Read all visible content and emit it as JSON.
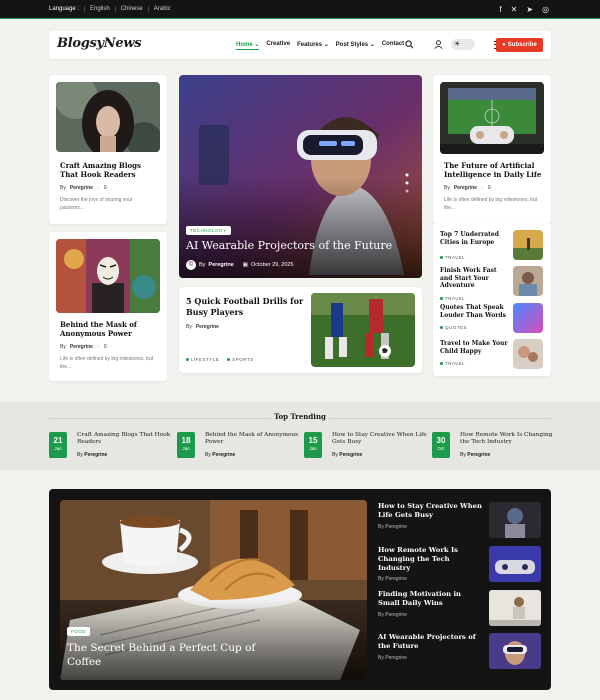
{
  "topbar": {
    "language_label": "Language :",
    "languages": [
      "English",
      "Chinese",
      "Arabic"
    ],
    "social_icons": [
      "facebook-icon",
      "x-icon",
      "telegram-icon",
      "instagram-icon"
    ]
  },
  "header": {
    "logo": "BlogsyNews",
    "nav": [
      "Home",
      "Creative",
      "Features",
      "Post Styles",
      "Contact"
    ],
    "subscribe_label": "Subscribe",
    "accent_color": "#1d9b4a",
    "subscribe_color": "#e63a27"
  },
  "left_cards": [
    {
      "title": "Craft Amazing Blogs That Hook Readers",
      "by": "By",
      "author": "Peregrine",
      "comments": "0",
      "excerpt": "Discover the joys of sharing your passions..."
    },
    {
      "title": "Behind the Mask of Anonymous Power",
      "by": "By",
      "author": "Peregrine",
      "comments": "0",
      "excerpt": "Life is often defined by big milestones, but the..."
    }
  ],
  "hero": {
    "category": "TECHNOLOGY",
    "title": "AI Wearable Projectors of the Future",
    "by": "By",
    "author": "Peregrine",
    "date": "October 29, 2025"
  },
  "football": {
    "title": "5 Quick Football Drills for Busy Players",
    "by": "By",
    "author": "Peregrine",
    "tags": [
      "LIFESTYLE",
      "SPORTS"
    ]
  },
  "right_card": {
    "title": "The Future of Artificial Intelligence in Daily Life",
    "by": "By",
    "author": "Peregrine",
    "comments": "0",
    "excerpt": "Life is often defined by big milestones, but the..."
  },
  "right_list": [
    {
      "title": "Top 7 Underrated Cities in Europe",
      "tag": "TRAVEL"
    },
    {
      "title": "Finish Work Fast and Start Your Adventure",
      "tag": "TRAVEL"
    },
    {
      "title": "Quotes That Speak Louder Than Words",
      "tag": "QUOTES"
    },
    {
      "title": "Travel to Make Your Child Happy",
      "tag": "TRAVEL"
    }
  ],
  "trending": {
    "heading": "Top Trending",
    "items": [
      {
        "day": "21",
        "month": "Jan",
        "title": "Craft Amazing Blogs That Hook Readers",
        "by": "By",
        "author": "Peregrine"
      },
      {
        "day": "18",
        "month": "Jan",
        "title": "Behind the Mask of Anonymous Power",
        "by": "By",
        "author": "Peregrine"
      },
      {
        "day": "15",
        "month": "Jan",
        "title": "How to Stay Creative When Life Gets Busy",
        "by": "By",
        "author": "Peregrine"
      },
      {
        "day": "30",
        "month": "Oct",
        "title": "How Remote Work Is Changing the Tech Industry",
        "by": "By",
        "author": "Peregrine"
      }
    ]
  },
  "dark_section": {
    "feature": {
      "category": "FOOD",
      "title": "The Secret Behind a Perfect Cup of Coffee"
    },
    "items": [
      {
        "title": "How to Stay Creative When Life Gets Busy",
        "by": "By",
        "author": "Peregrine"
      },
      {
        "title": "How Remote Work Is Changing the Tech Industry",
        "by": "By",
        "author": "Peregrine"
      },
      {
        "title": "Finding Motivation in Small Daily Wins",
        "by": "By",
        "author": "Peregrine"
      },
      {
        "title": "AI Wearable Projectors of the Future",
        "by": "By",
        "author": "Peregrine"
      }
    ]
  }
}
